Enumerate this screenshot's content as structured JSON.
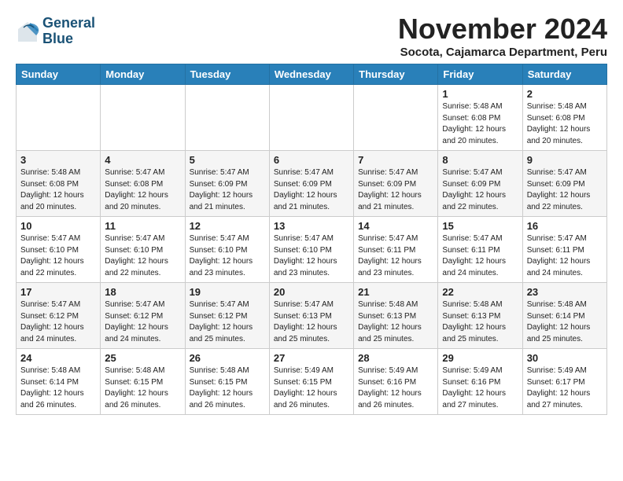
{
  "logo": {
    "line1": "General",
    "line2": "Blue"
  },
  "title": "November 2024",
  "location": "Socota, Cajamarca Department, Peru",
  "days_of_week": [
    "Sunday",
    "Monday",
    "Tuesday",
    "Wednesday",
    "Thursday",
    "Friday",
    "Saturday"
  ],
  "weeks": [
    [
      {
        "day": "",
        "info": ""
      },
      {
        "day": "",
        "info": ""
      },
      {
        "day": "",
        "info": ""
      },
      {
        "day": "",
        "info": ""
      },
      {
        "day": "",
        "info": ""
      },
      {
        "day": "1",
        "info": "Sunrise: 5:48 AM\nSunset: 6:08 PM\nDaylight: 12 hours and 20 minutes."
      },
      {
        "day": "2",
        "info": "Sunrise: 5:48 AM\nSunset: 6:08 PM\nDaylight: 12 hours and 20 minutes."
      }
    ],
    [
      {
        "day": "3",
        "info": "Sunrise: 5:48 AM\nSunset: 6:08 PM\nDaylight: 12 hours and 20 minutes."
      },
      {
        "day": "4",
        "info": "Sunrise: 5:47 AM\nSunset: 6:08 PM\nDaylight: 12 hours and 20 minutes."
      },
      {
        "day": "5",
        "info": "Sunrise: 5:47 AM\nSunset: 6:09 PM\nDaylight: 12 hours and 21 minutes."
      },
      {
        "day": "6",
        "info": "Sunrise: 5:47 AM\nSunset: 6:09 PM\nDaylight: 12 hours and 21 minutes."
      },
      {
        "day": "7",
        "info": "Sunrise: 5:47 AM\nSunset: 6:09 PM\nDaylight: 12 hours and 21 minutes."
      },
      {
        "day": "8",
        "info": "Sunrise: 5:47 AM\nSunset: 6:09 PM\nDaylight: 12 hours and 22 minutes."
      },
      {
        "day": "9",
        "info": "Sunrise: 5:47 AM\nSunset: 6:09 PM\nDaylight: 12 hours and 22 minutes."
      }
    ],
    [
      {
        "day": "10",
        "info": "Sunrise: 5:47 AM\nSunset: 6:10 PM\nDaylight: 12 hours and 22 minutes."
      },
      {
        "day": "11",
        "info": "Sunrise: 5:47 AM\nSunset: 6:10 PM\nDaylight: 12 hours and 22 minutes."
      },
      {
        "day": "12",
        "info": "Sunrise: 5:47 AM\nSunset: 6:10 PM\nDaylight: 12 hours and 23 minutes."
      },
      {
        "day": "13",
        "info": "Sunrise: 5:47 AM\nSunset: 6:10 PM\nDaylight: 12 hours and 23 minutes."
      },
      {
        "day": "14",
        "info": "Sunrise: 5:47 AM\nSunset: 6:11 PM\nDaylight: 12 hours and 23 minutes."
      },
      {
        "day": "15",
        "info": "Sunrise: 5:47 AM\nSunset: 6:11 PM\nDaylight: 12 hours and 24 minutes."
      },
      {
        "day": "16",
        "info": "Sunrise: 5:47 AM\nSunset: 6:11 PM\nDaylight: 12 hours and 24 minutes."
      }
    ],
    [
      {
        "day": "17",
        "info": "Sunrise: 5:47 AM\nSunset: 6:12 PM\nDaylight: 12 hours and 24 minutes."
      },
      {
        "day": "18",
        "info": "Sunrise: 5:47 AM\nSunset: 6:12 PM\nDaylight: 12 hours and 24 minutes."
      },
      {
        "day": "19",
        "info": "Sunrise: 5:47 AM\nSunset: 6:12 PM\nDaylight: 12 hours and 25 minutes."
      },
      {
        "day": "20",
        "info": "Sunrise: 5:47 AM\nSunset: 6:13 PM\nDaylight: 12 hours and 25 minutes."
      },
      {
        "day": "21",
        "info": "Sunrise: 5:48 AM\nSunset: 6:13 PM\nDaylight: 12 hours and 25 minutes."
      },
      {
        "day": "22",
        "info": "Sunrise: 5:48 AM\nSunset: 6:13 PM\nDaylight: 12 hours and 25 minutes."
      },
      {
        "day": "23",
        "info": "Sunrise: 5:48 AM\nSunset: 6:14 PM\nDaylight: 12 hours and 25 minutes."
      }
    ],
    [
      {
        "day": "24",
        "info": "Sunrise: 5:48 AM\nSunset: 6:14 PM\nDaylight: 12 hours and 26 minutes."
      },
      {
        "day": "25",
        "info": "Sunrise: 5:48 AM\nSunset: 6:15 PM\nDaylight: 12 hours and 26 minutes."
      },
      {
        "day": "26",
        "info": "Sunrise: 5:48 AM\nSunset: 6:15 PM\nDaylight: 12 hours and 26 minutes."
      },
      {
        "day": "27",
        "info": "Sunrise: 5:49 AM\nSunset: 6:15 PM\nDaylight: 12 hours and 26 minutes."
      },
      {
        "day": "28",
        "info": "Sunrise: 5:49 AM\nSunset: 6:16 PM\nDaylight: 12 hours and 26 minutes."
      },
      {
        "day": "29",
        "info": "Sunrise: 5:49 AM\nSunset: 6:16 PM\nDaylight: 12 hours and 27 minutes."
      },
      {
        "day": "30",
        "info": "Sunrise: 5:49 AM\nSunset: 6:17 PM\nDaylight: 12 hours and 27 minutes."
      }
    ]
  ]
}
